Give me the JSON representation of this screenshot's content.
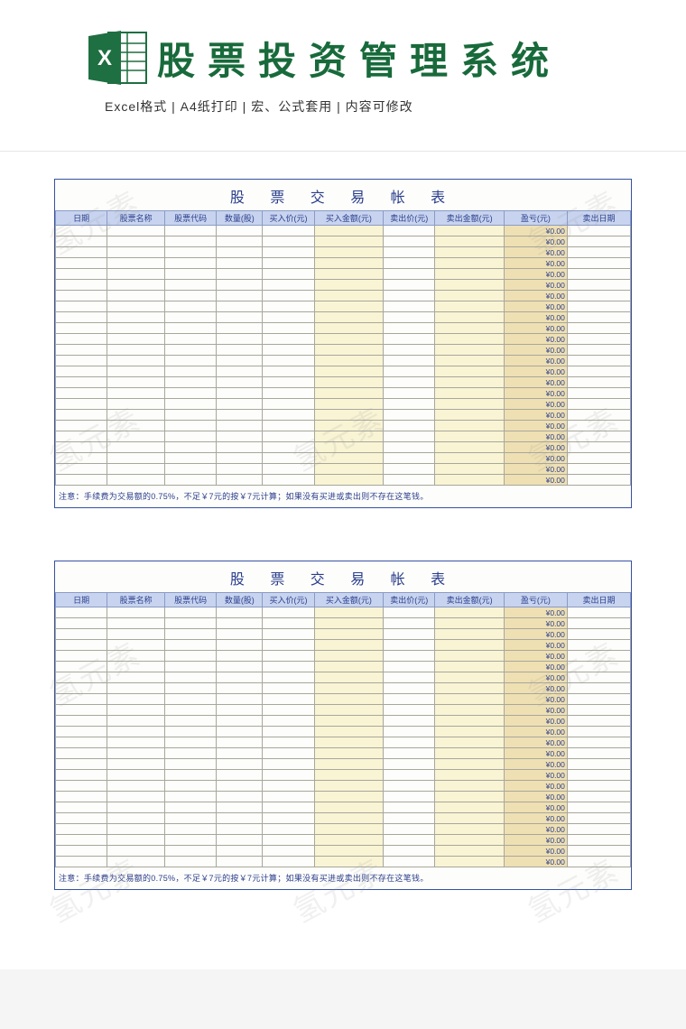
{
  "header": {
    "title": "股票投资管理系统",
    "subtitle_parts": [
      "Excel格式",
      "A4纸打印",
      "宏、公式套用",
      "内容可修改"
    ],
    "subtitle_separator": " |  "
  },
  "sheet": {
    "title": "股 票 交 易 帐 表",
    "columns": [
      "日期",
      "股票名称",
      "股票代码",
      "数量(股)",
      "买入价(元)",
      "买入金额(元)",
      "卖出价(元)",
      "卖出金额(元)",
      "盈亏(元)",
      "卖出日期"
    ],
    "pl_default": "¥0.00",
    "row_count": 24,
    "footer_note": "注意：手续费为交易额的0.75%，不足￥7元的按￥7元计算；如果没有买进或卖出则不存在这笔钱。"
  },
  "watermark_text": "氢元素"
}
